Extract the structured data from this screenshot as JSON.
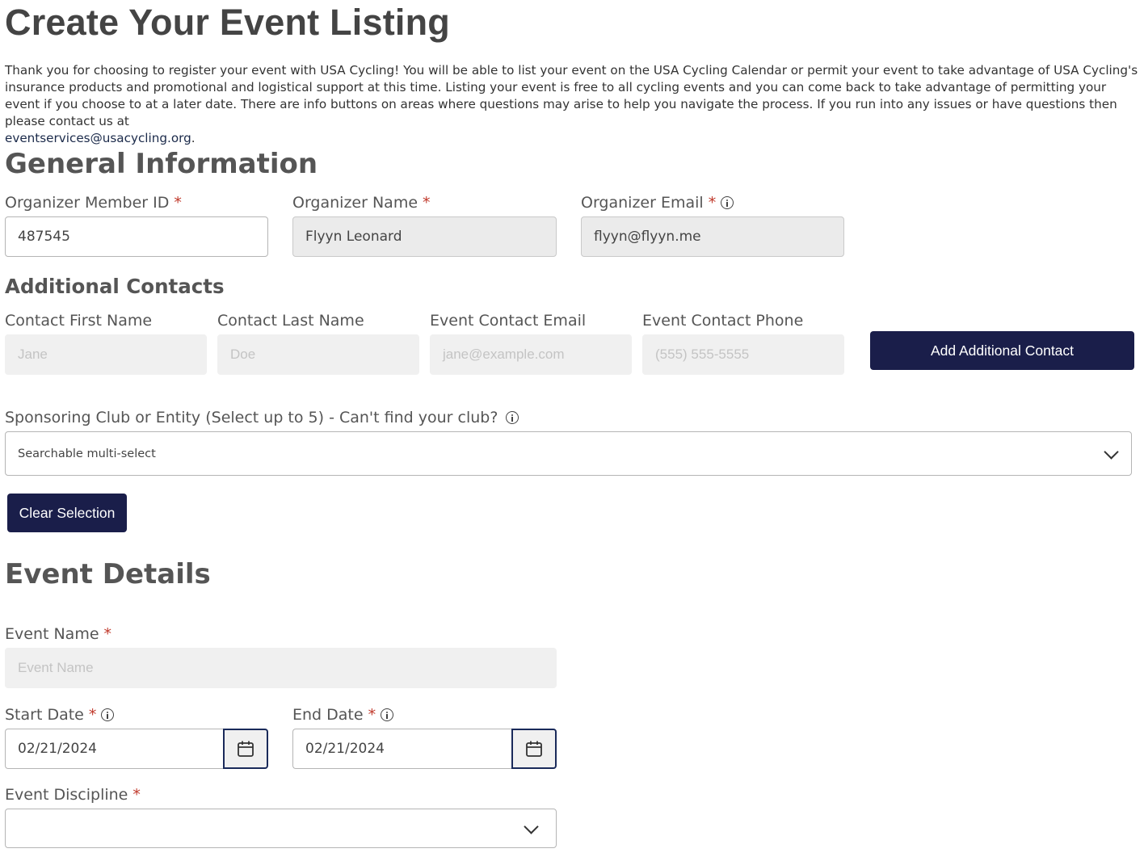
{
  "header": {
    "title": "Create Your Event Listing",
    "intro": "Thank you for choosing to register your event with USA Cycling! You will be able to list your event on the USA Cycling Calendar or permit your event to take advantage of USA Cycling's insurance products and promotional and logistical support at this time. Listing your event is free to all cycling events and you can come back to take advantage of permitting your event if you choose to at a later date. There are info buttons on areas where questions may arise to help you navigate the process. If you run into any issues or have questions then please contact us at",
    "contact_email": "eventservices@usacycling.org",
    "intro_end": "."
  },
  "general": {
    "title": "General Information",
    "member_id_label": "Organizer Member ID",
    "member_id_value": "487545",
    "name_label": "Organizer Name",
    "name_value": "Flyyn Leonard",
    "email_label": "Organizer Email",
    "email_value": "flyyn@flyyn.me",
    "required_mark": "*"
  },
  "contacts": {
    "title": "Additional Contacts",
    "first_name_label": "Contact First Name",
    "first_name_placeholder": "Jane",
    "last_name_label": "Contact Last Name",
    "last_name_placeholder": "Doe",
    "email_label": "Event Contact Email",
    "email_placeholder": "jane@example.com",
    "phone_label": "Event Contact Phone",
    "phone_placeholder": "(555) 555-5555",
    "add_button": "Add Additional Contact"
  },
  "sponsoring": {
    "label": "Sponsoring Club or Entity (Select up to 5) - Can't find your club?",
    "placeholder": "Searchable multi-select",
    "clear_button": "Clear Selection"
  },
  "event": {
    "title": "Event Details",
    "name_label": "Event Name",
    "name_placeholder": "Event Name",
    "start_label": "Start Date",
    "start_value": "02/21/2024",
    "end_label": "End Date",
    "end_value": "02/21/2024",
    "discipline_label": "Event Discipline",
    "discipline_value": ""
  },
  "icons": {
    "info": "info-icon",
    "calendar": "calendar-icon",
    "chevron": "chevron-down-icon"
  },
  "colors": {
    "primary_button": "#1a1e4a",
    "required": "#c0392b",
    "heading": "#555555"
  }
}
